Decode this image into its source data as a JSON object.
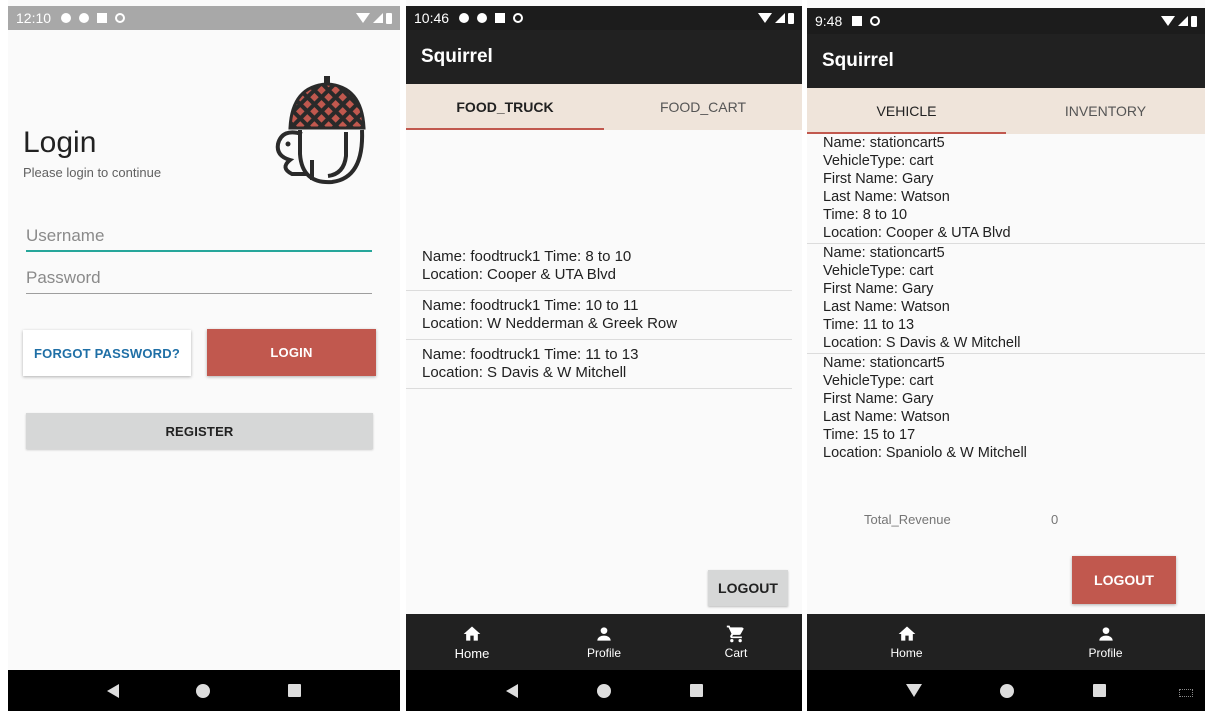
{
  "screens": {
    "login": {
      "status_time": "12:10",
      "title": "Login",
      "subtitle": "Please login to continue",
      "username_placeholder": "Username",
      "password_placeholder": "Password",
      "forgot_label": "FORGOT PASSWORD?",
      "login_label": "LOGIN",
      "register_label": "REGISTER"
    },
    "food": {
      "status_time": "10:46",
      "app_title": "Squirrel",
      "tabs": [
        {
          "label": "FOOD_TRUCK",
          "active": true
        },
        {
          "label": "FOOD_CART",
          "active": false
        }
      ],
      "entries": [
        {
          "line1": "Name: foodtruck1 Time: 8 to 10",
          "line2": "Location: Cooper & UTA Blvd"
        },
        {
          "line1": "Name: foodtruck1 Time: 10 to 11",
          "line2": "Location: W Nedderman & Greek Row"
        },
        {
          "line1": "Name: foodtruck1 Time: 11 to 13",
          "line2": "Location: S Davis & W Mitchell"
        }
      ],
      "logout_label": "LOGOUT",
      "nav": [
        {
          "label": "Home",
          "icon": "home-icon"
        },
        {
          "label": "Profile",
          "icon": "person-icon"
        },
        {
          "label": "Cart",
          "icon": "cart-icon"
        }
      ]
    },
    "vehicle": {
      "status_time": "9:48",
      "app_title": "Squirrel",
      "tabs": [
        {
          "label": "VEHICLE",
          "active": true
        },
        {
          "label": "INVENTORY",
          "active": false
        }
      ],
      "entries": [
        {
          "name": "Name: stationcart5",
          "type": "VehicleType: cart",
          "first": "First Name: Gary",
          "last": "Last Name: Watson",
          "time": "Time: 8 to 10",
          "location": "Location: Cooper & UTA Blvd"
        },
        {
          "name": "Name: stationcart5",
          "type": "VehicleType: cart",
          "first": "First Name: Gary",
          "last": "Last Name: Watson",
          "time": "Time: 11 to 13",
          "location": "Location: S Davis & W Mitchell"
        },
        {
          "name": "Name: stationcart5",
          "type": "VehicleType: cart",
          "first": "First Name: Gary",
          "last": "Last Name: Watson",
          "time": "Time: 15 to 17",
          "location": "Location: Spaniolo & W Mitchell"
        }
      ],
      "revenue_label": "Total_Revenue",
      "revenue_value": "0",
      "logout_label": "LOGOUT",
      "nav": [
        {
          "label": "Home",
          "icon": "home-icon"
        },
        {
          "label": "Profile",
          "icon": "person-icon"
        }
      ]
    }
  },
  "colors": {
    "accent": "#c1584e",
    "teal": "#26a69a",
    "link": "#1f6fa6",
    "tab_bg": "#efe4da",
    "appbar": "#212121"
  }
}
